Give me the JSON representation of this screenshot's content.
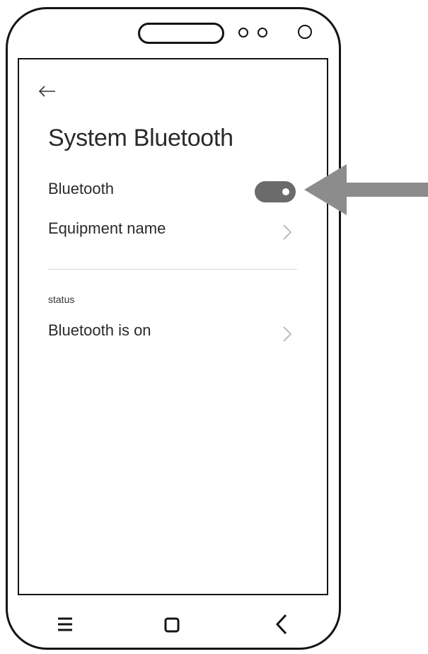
{
  "screen": {
    "back_icon": "back-arrow-icon",
    "title": "System Bluetooth",
    "rows": [
      {
        "label": "Bluetooth",
        "control": "toggle",
        "toggle_on": true
      },
      {
        "label": "Equipment name",
        "control": "chevron-right-icon"
      }
    ],
    "status_section": {
      "heading": "status",
      "value": "Bluetooth is on",
      "control": "chevron-right-icon"
    }
  },
  "navbar": {
    "icons": [
      "menu-icon",
      "home-square-icon",
      "back-chevron-icon"
    ]
  },
  "colors": {
    "frame": "#141414",
    "toggle_on": "#6b6b6b",
    "callout_arrow": "#8c8c8c",
    "divider": "#d9d9d9",
    "chevron": "#b5b5b5"
  }
}
